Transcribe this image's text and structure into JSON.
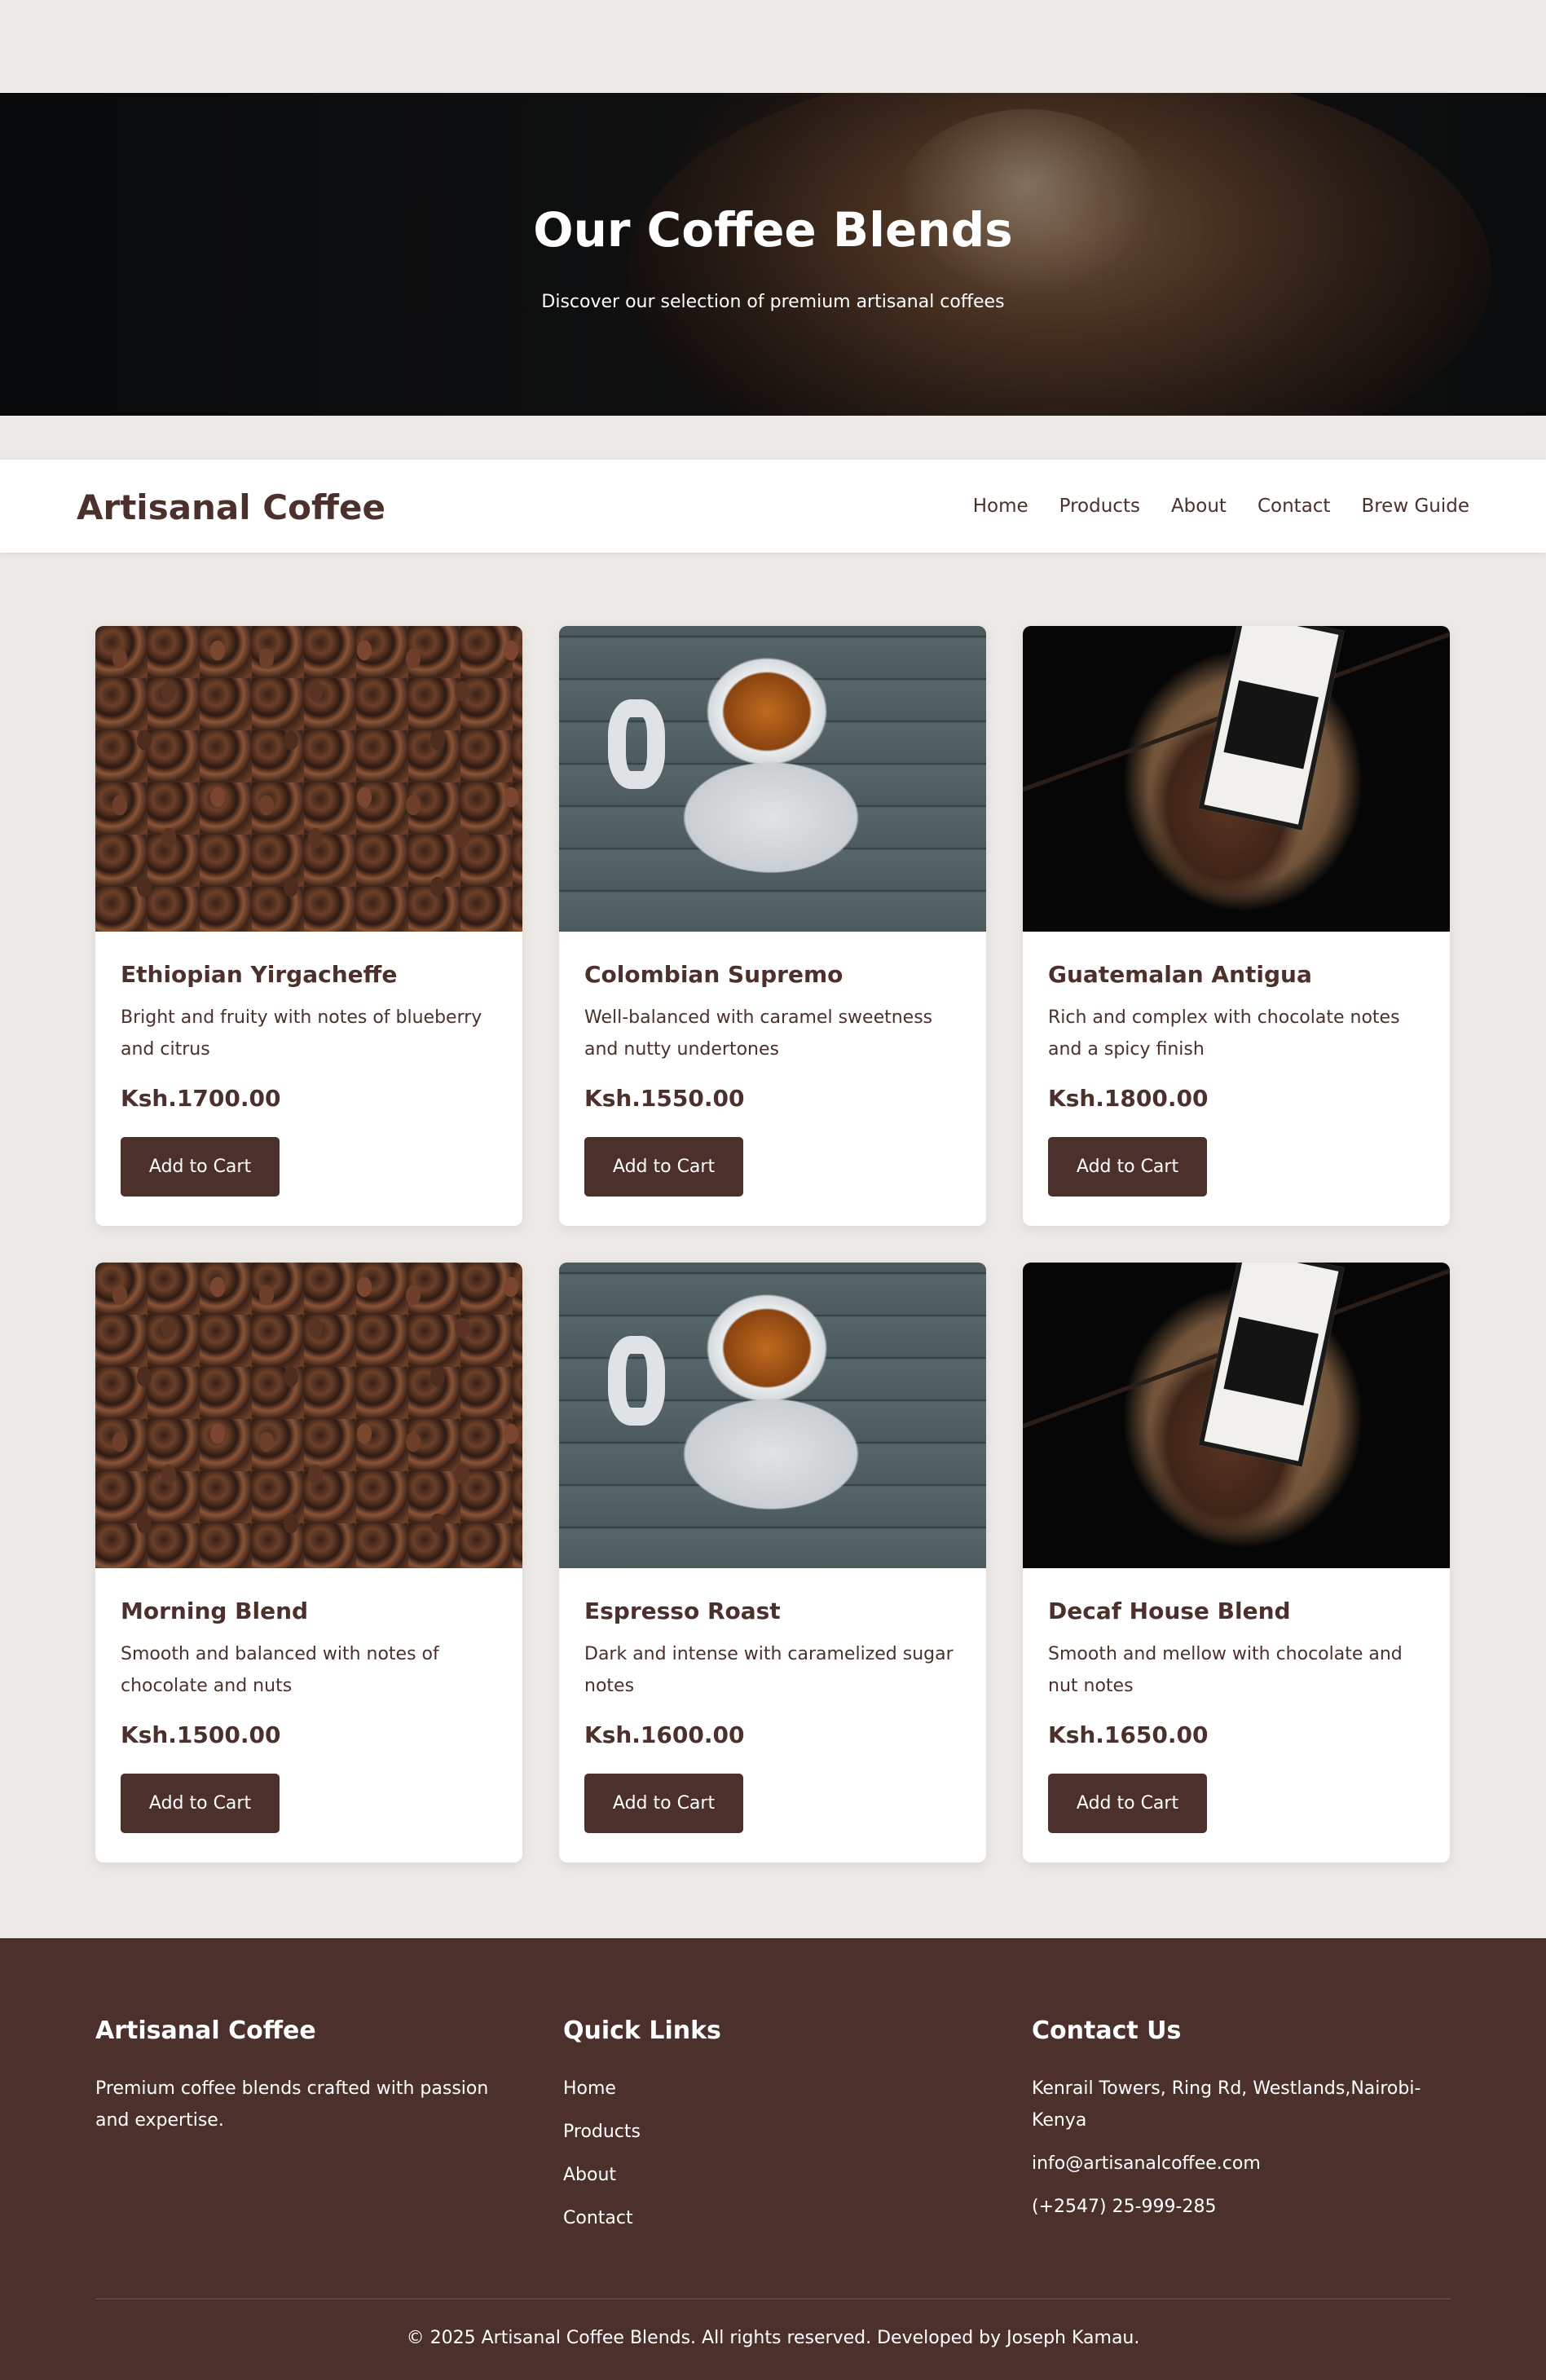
{
  "hero": {
    "title": "Our Coffee Blends",
    "subtitle": "Discover our selection of premium artisanal coffees"
  },
  "nav": {
    "brand": "Artisanal Coffee",
    "links": [
      "Home",
      "Products",
      "About",
      "Contact",
      "Brew Guide"
    ]
  },
  "products": [
    {
      "name": "Ethiopian Yirgacheffe",
      "description": "Bright and fruity with notes of blueberry and citrus",
      "price": "Ksh.1700.00",
      "button": "Add to Cart",
      "image": "coffee-beans"
    },
    {
      "name": "Colombian Supremo",
      "description": "Well-balanced with caramel sweetness and nutty undertones",
      "price": "Ksh.1550.00",
      "button": "Add to Cart",
      "image": "espresso-cup"
    },
    {
      "name": "Guatemalan Antigua",
      "description": "Rich and complex with chocolate notes and a spicy finish",
      "price": "Ksh.1800.00",
      "button": "Add to Cart",
      "image": "coffee-bag"
    },
    {
      "name": "Morning Blend",
      "description": "Smooth and balanced with notes of chocolate and nuts",
      "price": "Ksh.1500.00",
      "button": "Add to Cart",
      "image": "coffee-beans"
    },
    {
      "name": "Espresso Roast",
      "description": "Dark and intense with caramelized sugar notes",
      "price": "Ksh.1600.00",
      "button": "Add to Cart",
      "image": "espresso-cup"
    },
    {
      "name": "Decaf House Blend",
      "description": "Smooth and mellow with chocolate and nut notes",
      "price": "Ksh.1650.00",
      "button": "Add to Cart",
      "image": "coffee-bag"
    }
  ],
  "footer": {
    "about": {
      "title": "Artisanal Coffee",
      "text": "Premium coffee blends crafted with passion and expertise."
    },
    "quick_links": {
      "title": "Quick Links",
      "links": [
        "Home",
        "Products",
        "About",
        "Contact"
      ]
    },
    "contact": {
      "title": "Contact Us",
      "address": "Kenrail Towers, Ring Rd, Westlands,Nairobi-Kenya",
      "email": "info@artisanalcoffee.com",
      "phone": "(+2547) 25-999-285"
    },
    "copyright": "© 2025 Artisanal Coffee Blends. All rights reserved. Developed by Joseph Kamau."
  },
  "colors": {
    "brand": "#4b302b",
    "background": "#ede9e6",
    "card": "#ffffff"
  }
}
